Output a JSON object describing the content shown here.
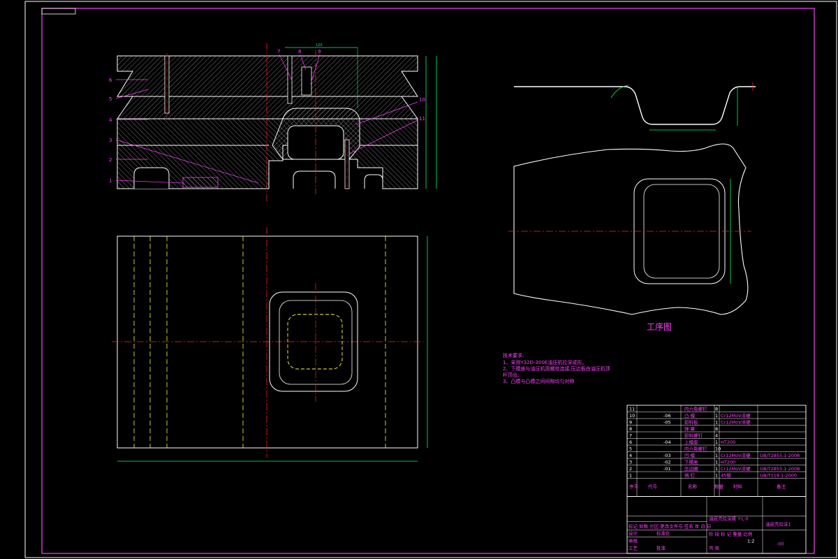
{
  "drawing": {
    "section_view": {
      "part_labels_left": [
        "6",
        "5",
        "4",
        "3",
        "2",
        "1"
      ],
      "part_labels_top": [
        "7",
        "8",
        "9"
      ],
      "part_labels_right": [
        "10",
        "11"
      ],
      "dim_top": "120"
    },
    "process_drawing": {
      "caption": "工序图"
    },
    "tech_requirements": {
      "title": "技术要求:",
      "lines": [
        "1、采用Y32D-300E油压机拉深成形。",
        "2、下模座与油压机用螺栓连接,压边板由油压机顶",
        "杆顶出;",
        "3、凸模与凸模之间间隙均匀对称"
      ]
    },
    "title_block": {
      "bom_rows": [
        {
          "no": "11",
          "code": "",
          "name": "内六角螺钉",
          "qty": "8",
          "material": "",
          "note": ""
        },
        {
          "no": "10",
          "code": "-06",
          "name": "凸 模",
          "qty": "1",
          "material": "Cr12MoV淬硬",
          "note": ""
        },
        {
          "no": "9",
          "code": "-05",
          "name": "卸料板",
          "qty": "1",
          "material": "Cr12MoV淬硬",
          "note": ""
        },
        {
          "no": "8",
          "code": "",
          "name": "弹 簧",
          "qty": "8",
          "material": "",
          "note": ""
        },
        {
          "no": "7",
          "code": "",
          "name": "卸料螺钉",
          "qty": "4",
          "material": "",
          "note": ""
        },
        {
          "no": "6",
          "code": "-04",
          "name": "上模座",
          "qty": "1",
          "material": "HT200",
          "note": ""
        },
        {
          "no": "5",
          "code": "",
          "name": "内六角螺钉",
          "qty": "10",
          "material": "",
          "note": ""
        },
        {
          "no": "4",
          "code": "-03",
          "name": "凹 模",
          "qty": "1",
          "material": "Cr12MoV淬硬",
          "note": "GB/T2855.1-2008"
        },
        {
          "no": "3",
          "code": "-02",
          "name": "下模座",
          "qty": "1",
          "material": "HT200",
          "note": ""
        },
        {
          "no": "2",
          "code": "-01",
          "name": "压边圈",
          "qty": "1",
          "material": "Cr12MoV淬硬",
          "note": "GB/T2855.1-2008"
        },
        {
          "no": "1",
          "code": "",
          "name": "销 钉",
          "qty": "1",
          "material": "45钢",
          "note": "GB/T119.1-2000"
        }
      ],
      "header": {
        "no": "序号",
        "code": "代号",
        "name": "名称",
        "qty": "数量",
        "material": "材料",
        "note": "备注"
      },
      "drawing_name": "油底壳拉深模 Y-L-0",
      "title": "油底壳拉深1",
      "drawing_no": "-00",
      "sign_row": "标记 处数 分区 更改文件号 签名 年 月 日",
      "design": "设计",
      "std": "标准化",
      "review": "审核",
      "craft": "工艺",
      "approve": "批准",
      "stage_row": "阶 段 标 记 重量 比例",
      "scale": "1:2",
      "sheet": "共 张"
    }
  }
}
